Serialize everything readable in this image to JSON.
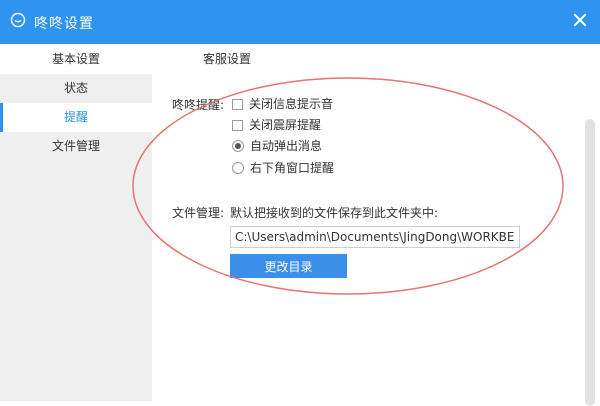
{
  "window": {
    "title": "咚咚设置"
  },
  "tabs": {
    "basic": "基本设置",
    "service": "客服设置"
  },
  "sidebar": {
    "items": [
      {
        "label": "状态"
      },
      {
        "label": "提醒",
        "active": true
      },
      {
        "label": "文件管理"
      }
    ]
  },
  "reminder": {
    "label": "咚咚提醒:",
    "options": {
      "close_info_sound": {
        "label": "关闭信息提示音",
        "checked": false
      },
      "close_shake": {
        "label": "关闭震屏提醒",
        "checked": false
      },
      "auto_popup": {
        "label": "自动弹出消息",
        "selected": true
      },
      "corner_popup": {
        "label": "右下角窗口提醒",
        "selected": false
      }
    }
  },
  "file_mgmt": {
    "label": "文件管理:",
    "description": "默认把接收到的文件保存到此文件夹中:",
    "path": "C:\\Users\\admin\\Documents\\JingDong\\WORKBENCH",
    "change_button": "更改目录"
  },
  "colors": {
    "accent": "#2d95f0",
    "annotation": "#e57373"
  },
  "icons": {
    "app": "chat-bubble-icon",
    "close": "close-icon"
  }
}
